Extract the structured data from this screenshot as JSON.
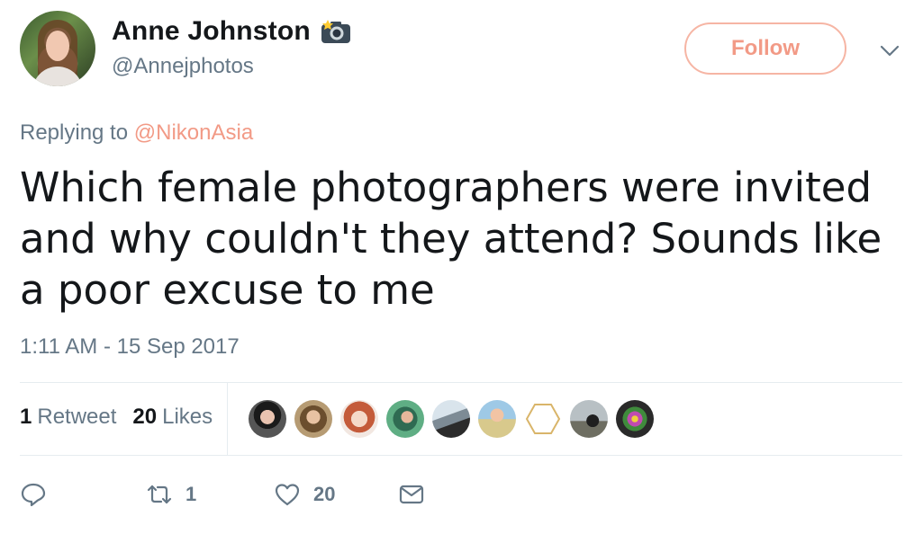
{
  "author": {
    "name": "Anne Johnston",
    "handle": "@Annejphotos",
    "badge_icon": "camera-flash-icon"
  },
  "follow_label": "Follow",
  "reply": {
    "prefix": "Replying to",
    "mention": "@NikonAsia"
  },
  "tweet": {
    "text": "Which female photographers were invited and why couldn't they attend? Sounds like a poor excuse to me",
    "timestamp": "1:11 AM - 15 Sep 2017"
  },
  "stats": {
    "retweets_count": "1",
    "retweets_label": "Retweet",
    "likes_count": "20",
    "likes_label": "Likes"
  },
  "actions": {
    "retweet_count": "1",
    "like_count": "20"
  },
  "colors": {
    "accent": "#f29a86",
    "muted": "#657786",
    "text": "#14171a"
  }
}
